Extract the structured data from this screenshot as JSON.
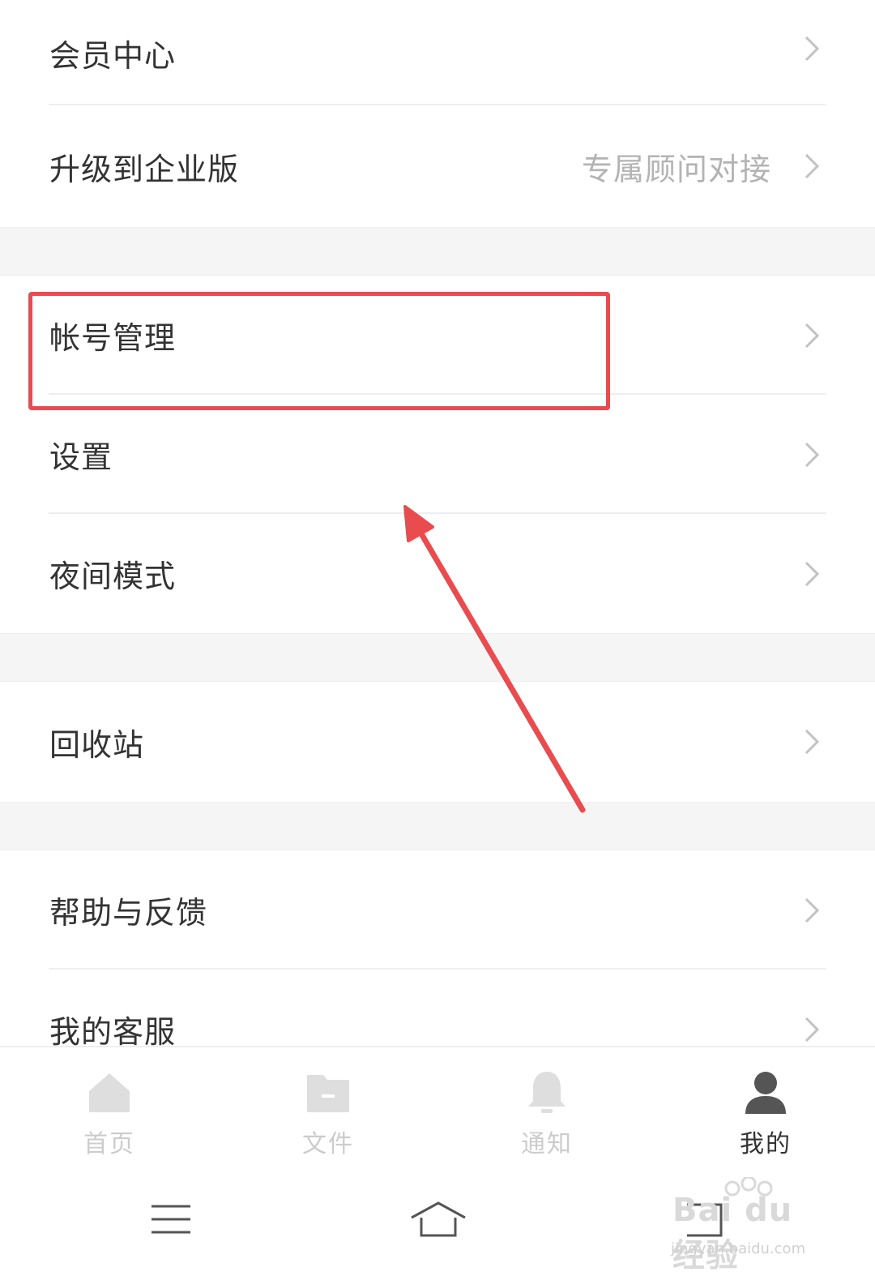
{
  "menu": {
    "group1": [
      {
        "label": "会员中心",
        "value": ""
      },
      {
        "label": "升级到企业版",
        "value": "专属顾问对接"
      }
    ],
    "group2": [
      {
        "label": "帐号管理"
      },
      {
        "label": "设置"
      },
      {
        "label": "夜间模式"
      }
    ],
    "group3": [
      {
        "label": "回收站"
      }
    ],
    "group4": [
      {
        "label": "帮助与反馈"
      },
      {
        "label": "我的客服"
      }
    ]
  },
  "tabbar": {
    "tabs": [
      {
        "label": "首页",
        "icon": "home-icon",
        "active": false
      },
      {
        "label": "文件",
        "icon": "folder-icon",
        "active": false
      },
      {
        "label": "通知",
        "icon": "bell-icon",
        "active": false
      },
      {
        "label": "我的",
        "icon": "user-icon",
        "active": true
      }
    ]
  },
  "system_nav": {
    "buttons": [
      "menu-icon",
      "home-outline-icon",
      "back-icon"
    ]
  },
  "watermark": {
    "text": "Bai du 经验",
    "url": "jingyan.baidu.com"
  },
  "colors": {
    "annotation_red": "#e84c4f",
    "text_primary": "#333333",
    "text_secondary": "#b3b3b3",
    "tab_inactive": "#cccccc",
    "tab_active": "#555555",
    "group_gap": "#f5f5f5"
  }
}
